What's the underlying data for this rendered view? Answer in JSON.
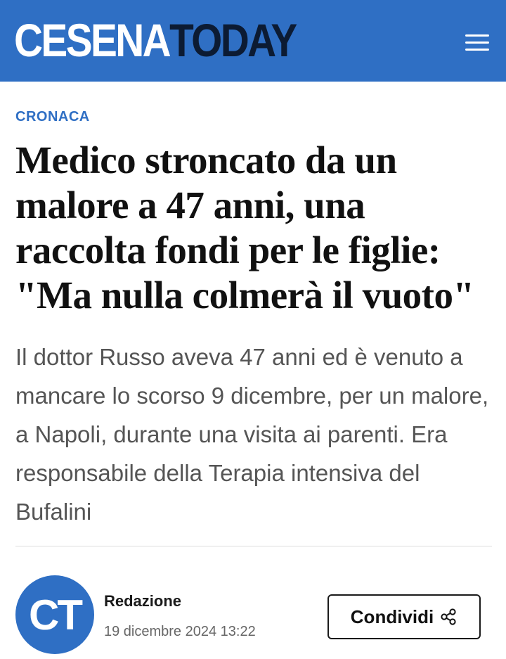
{
  "header": {
    "logo_part1": "CESENA",
    "logo_part2": "TODAY",
    "menu_icon": "hamburger-menu-icon",
    "background_color": "#2f6fc4"
  },
  "article": {
    "category": "CRONACA",
    "headline": "Medico stroncato da un malore a 47 anni, una raccolta fondi per le figlie: \"Ma nulla colmerà il vuoto\"",
    "summary": "Il dottor Russo aveva 47 anni ed è venuto a mancare lo scorso 9 dicembre, per un malore, a Napoli, durante una visita ai parenti. Era responsabile della Terapia intensiva del Bufalini"
  },
  "byline": {
    "avatar_initials": "CT",
    "author": "Redazione",
    "date": "19 dicembre 2024 13:22"
  },
  "share": {
    "label": "Condividi",
    "icon": "share-icon"
  },
  "colors": {
    "accent": "#2f6fc4",
    "logo_dark": "#0c1b33",
    "summary_text": "#555555"
  }
}
